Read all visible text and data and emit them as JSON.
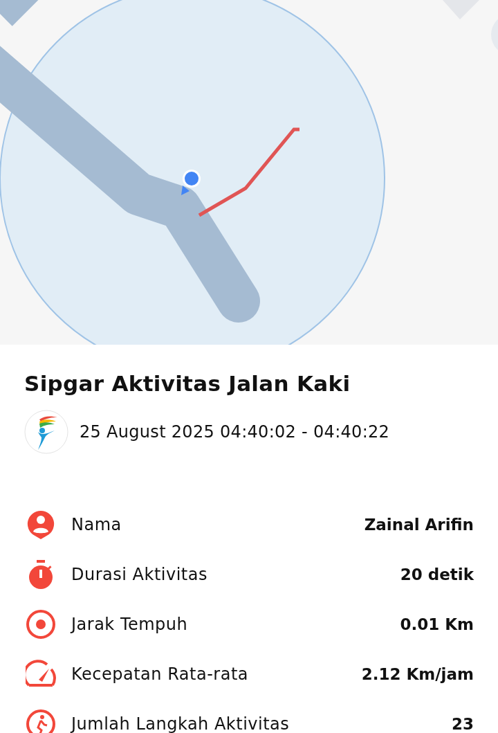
{
  "activity": {
    "title": "Sipgar Aktivitas Jalan Kaki",
    "datetime": "25 August 2025 04:40:02 - 04:40:22"
  },
  "stats": [
    {
      "kind": "person",
      "label": "Nama",
      "value": "Zainal Arifin"
    },
    {
      "kind": "timer",
      "label": "Durasi Aktivitas",
      "value": "20 detik"
    },
    {
      "kind": "target",
      "label": "Jarak Tempuh",
      "value": "0.01 Km"
    },
    {
      "kind": "speed",
      "label": "Kecepatan Rata-rata",
      "value": "2.12 Km/jam"
    },
    {
      "kind": "walk",
      "label": "Jumlah Langkah Aktivitas",
      "value": "23"
    }
  ]
}
